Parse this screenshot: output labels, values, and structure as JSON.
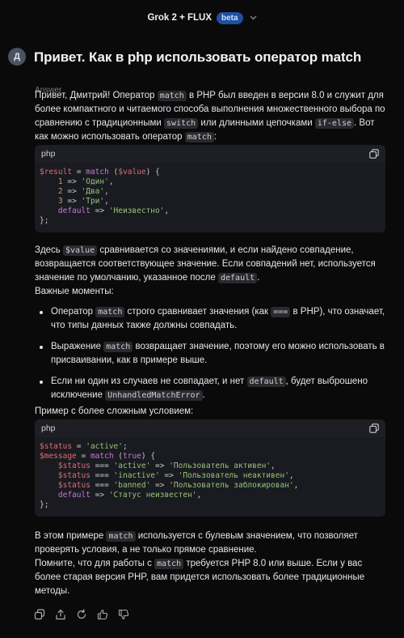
{
  "header": {
    "model_name": "Grok 2 + FLUX",
    "badge": "beta",
    "chevron_icon": "chevron-down-icon"
  },
  "question": {
    "avatar_letter": "Д",
    "text": "Привет. Как в php использовать оператор match"
  },
  "answer": {
    "label": "Answer",
    "intro": {
      "p1": "Привет, Дмитрий! Оператор ",
      "c1": "match",
      "p2": " в PHP был введен в версии 8.0 и служит для более компактного и читаемого способа выполнения множественного выбора по сравнению с традиционными ",
      "c2": "switch",
      "p3": " или длинными цепочками ",
      "c3": "if-else",
      "p4": ". Вот как можно использовать оператор ",
      "c4": "match",
      "p5": ":"
    },
    "code1": {
      "lang": "php",
      "lines": [
        [
          {
            "t": "$result",
            "c": "var"
          },
          {
            "t": " = ",
            "c": "op"
          },
          {
            "t": "match",
            "c": "kw"
          },
          {
            "t": " (",
            "c": "op"
          },
          {
            "t": "$value",
            "c": "var"
          },
          {
            "t": ") {",
            "c": "op"
          }
        ],
        [
          {
            "t": "    ",
            "c": "op"
          },
          {
            "t": "1",
            "c": "num"
          },
          {
            "t": " => ",
            "c": "op"
          },
          {
            "t": "'Один'",
            "c": "str"
          },
          {
            "t": ",",
            "c": "op"
          }
        ],
        [
          {
            "t": "    ",
            "c": "op"
          },
          {
            "t": "2",
            "c": "num"
          },
          {
            "t": " => ",
            "c": "op"
          },
          {
            "t": "'Два'",
            "c": "str"
          },
          {
            "t": ",",
            "c": "op"
          }
        ],
        [
          {
            "t": "    ",
            "c": "op"
          },
          {
            "t": "3",
            "c": "num"
          },
          {
            "t": " => ",
            "c": "op"
          },
          {
            "t": "'Три'",
            "c": "str"
          },
          {
            "t": ",",
            "c": "op"
          }
        ],
        [
          {
            "t": "    ",
            "c": "op"
          },
          {
            "t": "default",
            "c": "kw"
          },
          {
            "t": " => ",
            "c": "op"
          },
          {
            "t": "'Неизвестно'",
            "c": "str"
          },
          {
            "t": ",",
            "c": "op"
          }
        ],
        [
          {
            "t": "};",
            "c": "op"
          }
        ]
      ]
    },
    "explain": {
      "p1": "Здесь ",
      "c1": "$value",
      "p2": " сравнивается со значениями, и если найдено совпадение, возвращается соответствующее значение. Если совпадений нет, используется значение по умолчанию, указанное после ",
      "c2": "default",
      "p3": "."
    },
    "important_heading": "Важные моменты:",
    "bullets": [
      {
        "p1": "Оператор ",
        "c1": "match",
        "p2": " строго сравнивает значения (как ",
        "c2": "===",
        "p3": " в PHP), что означает, что типы данных также должны совпадать."
      },
      {
        "p1": "Выражение ",
        "c1": "match",
        "p2": " возвращает значение, поэтому его можно использовать в присваивании, как в примере выше.",
        "c2": "",
        "p3": ""
      },
      {
        "p1": "Если ни один из случаев не совпадает, и нет ",
        "c1": "default",
        "p2": ", будет выброшено исключение ",
        "c2": "UnhandledMatchError",
        "p3": "."
      }
    ],
    "complex_heading": "Пример с более сложным условием:",
    "code2": {
      "lang": "php",
      "lines": [
        [
          {
            "t": "$status",
            "c": "var"
          },
          {
            "t": " = ",
            "c": "op"
          },
          {
            "t": "'active'",
            "c": "str"
          },
          {
            "t": ";",
            "c": "op"
          }
        ],
        [
          {
            "t": "$message",
            "c": "var"
          },
          {
            "t": " = ",
            "c": "op"
          },
          {
            "t": "match",
            "c": "kw"
          },
          {
            "t": " (",
            "c": "op"
          },
          {
            "t": "true",
            "c": "kw"
          },
          {
            "t": ") {",
            "c": "op"
          }
        ],
        [
          {
            "t": "    ",
            "c": "op"
          },
          {
            "t": "$status",
            "c": "var"
          },
          {
            "t": " === ",
            "c": "op"
          },
          {
            "t": "'active'",
            "c": "str"
          },
          {
            "t": " => ",
            "c": "op"
          },
          {
            "t": "'Пользователь активен'",
            "c": "str"
          },
          {
            "t": ",",
            "c": "op"
          }
        ],
        [
          {
            "t": "    ",
            "c": "op"
          },
          {
            "t": "$status",
            "c": "var"
          },
          {
            "t": " === ",
            "c": "op"
          },
          {
            "t": "'inactive'",
            "c": "str"
          },
          {
            "t": " => ",
            "c": "op"
          },
          {
            "t": "'Пользователь неактивен'",
            "c": "str"
          },
          {
            "t": ",",
            "c": "op"
          }
        ],
        [
          {
            "t": "    ",
            "c": "op"
          },
          {
            "t": "$status",
            "c": "var"
          },
          {
            "t": " === ",
            "c": "op"
          },
          {
            "t": "'banned'",
            "c": "str"
          },
          {
            "t": " => ",
            "c": "op"
          },
          {
            "t": "'Пользователь заблокирован'",
            "c": "str"
          },
          {
            "t": ",",
            "c": "op"
          }
        ],
        [
          {
            "t": "    ",
            "c": "op"
          },
          {
            "t": "default",
            "c": "kw"
          },
          {
            "t": " => ",
            "c": "op"
          },
          {
            "t": "'Статус неизвестен'",
            "c": "str"
          },
          {
            "t": ",",
            "c": "op"
          }
        ],
        [
          {
            "t": "};",
            "c": "op"
          }
        ]
      ]
    },
    "outro1": {
      "p1": "В этом примере ",
      "c1": "match",
      "p2": " используется с булевым значением, что позволяет проверять условия, а не только прямое сравнение."
    },
    "outro2": {
      "p1": "Помните, что для работы с ",
      "c1": "match",
      "p2": " требуется PHP 8.0 или выше. Если у вас более старая версия PHP, вам придется использовать более традиционные методы."
    }
  },
  "actions": [
    "copy-icon",
    "share-icon",
    "regenerate-icon",
    "thumbs-up-icon",
    "thumbs-down-icon"
  ],
  "colors": {
    "background": "#0a0a0b",
    "badge": "#1e4fa0",
    "code_bg": "#191b20",
    "token_var": "#e06c75",
    "token_keyword": "#c678dd",
    "token_number": "#d19a66",
    "token_string": "#98c379"
  }
}
